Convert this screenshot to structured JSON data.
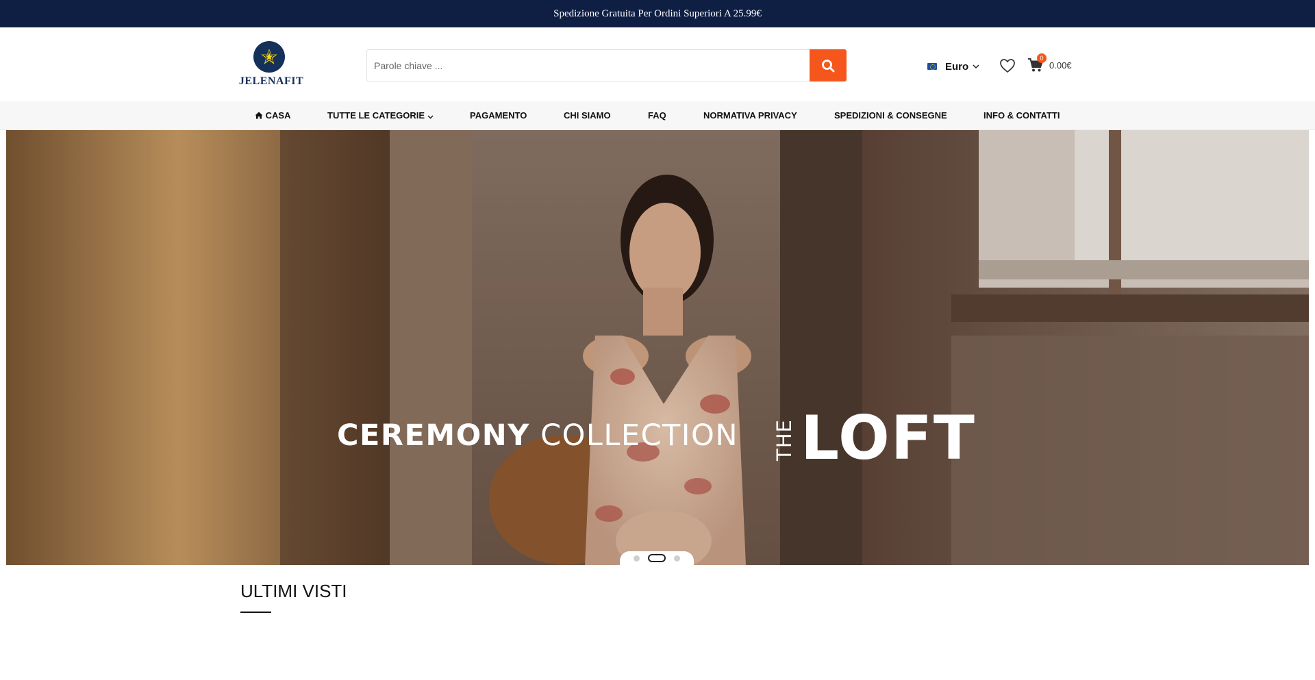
{
  "announcement": "Spedizione Gratuita Per Ordini Superiori A 25.99€",
  "brand": {
    "name": "JELENAFIT",
    "color": "#16305c",
    "star_color": "#f5d90a"
  },
  "search": {
    "placeholder": "Parole chiave ...",
    "button_color": "#f5561c"
  },
  "currency": {
    "label": "Euro"
  },
  "cart": {
    "count": "0",
    "total": "0.00€"
  },
  "nav": {
    "items": [
      {
        "label": "CASA",
        "icon": "home-icon"
      },
      {
        "label": "TUTTE LE CATEGORIE",
        "icon": "chevron-down-icon"
      },
      {
        "label": "PAGAMENTO"
      },
      {
        "label": "CHI SIAMO"
      },
      {
        "label": "FAQ"
      },
      {
        "label": "NORMATIVA PRIVACY"
      },
      {
        "label": "SPEDIZIONI & CONSEGNE"
      },
      {
        "label": "INFO & CONTATTI"
      }
    ]
  },
  "hero": {
    "line1_bold": "CEREMONY",
    "line1_light": "COLLECTION",
    "the": "THE",
    "loft": "LOFT",
    "slides_total": 3,
    "active_slide": 2
  },
  "section": {
    "title": "ULTIMI VISTI"
  }
}
